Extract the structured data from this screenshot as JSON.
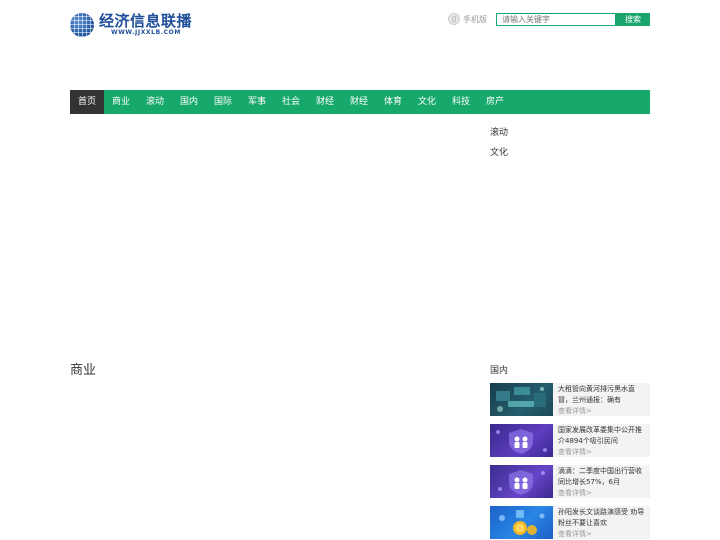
{
  "header": {
    "logo_name": "经济信息联播",
    "logo_url": "WWW.JJXXLB.COM",
    "mobile_label": "手机版",
    "search_placeholder": "请输入关键字",
    "search_button": "搜索"
  },
  "nav": [
    {
      "label": "首页",
      "active": true
    },
    {
      "label": "商业"
    },
    {
      "label": "滚动"
    },
    {
      "label": "国内"
    },
    {
      "label": "国际"
    },
    {
      "label": "军事"
    },
    {
      "label": "社会"
    },
    {
      "label": "财经"
    },
    {
      "label": "财经"
    },
    {
      "label": "体育"
    },
    {
      "label": "文化"
    },
    {
      "label": "科技"
    },
    {
      "label": "房产"
    }
  ],
  "side_links": [
    "滚动",
    "文化"
  ],
  "main_section_title": "商业",
  "side_section": {
    "title": "国内",
    "items": [
      {
        "title": "大租管向黄河排污黑水直冒，兰州通报：确有",
        "more": "查看详情>"
      },
      {
        "title": "国家发展改革委集中公开推介4894个吸引民间",
        "more": "查看详情>"
      },
      {
        "title": "滴滴：二季度中国出行营收同比增长57%，6月",
        "more": "查看详情>"
      },
      {
        "title": "孙阳发长文谈路演感受 劝导粉丝不要让喜欢",
        "more": "查看详情>"
      }
    ]
  },
  "colors": {
    "nav_bg": "#17a86b",
    "nav_active_bg": "#333333",
    "accent": "#1aa56c",
    "logo": "#1f4f9a"
  }
}
